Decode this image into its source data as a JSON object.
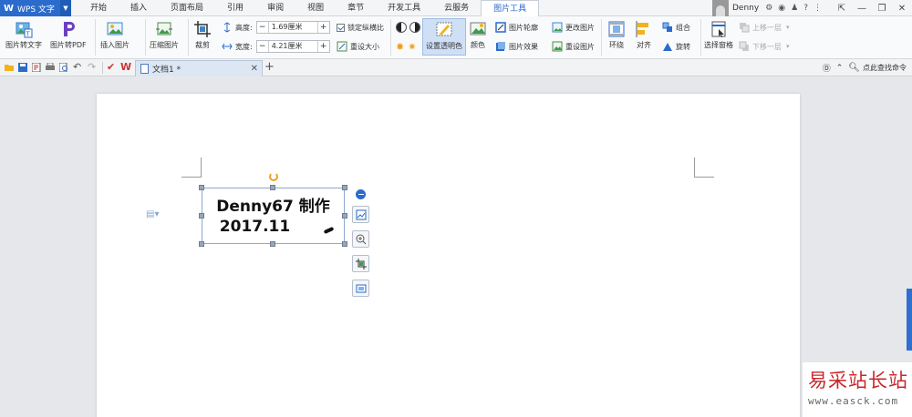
{
  "app": {
    "name": "WPS 文字",
    "logo": "W"
  },
  "menu_tabs": [
    "开始",
    "插入",
    "页面布局",
    "引用",
    "审阅",
    "视图",
    "章节",
    "开发工具",
    "云服务",
    "图片工具"
  ],
  "user": {
    "name": "Denny"
  },
  "ribbon": {
    "pic_to_text": "图片转文字",
    "pic_to_pdf": "图片转PDF",
    "insert_pic": "插入图片",
    "compress_pic": "压缩图片",
    "crop": "裁剪",
    "height_label": "高度:",
    "height_value": "1.69厘米",
    "width_label": "宽度:",
    "width_value": "4.21厘米",
    "lock_ratio": "锁定纵横比",
    "reset_size": "重设大小",
    "set_transparent": "设置透明色",
    "color": "颜色",
    "pic_outline": "图片轮廓",
    "pic_effect": "图片效果",
    "change_pic": "更改图片",
    "reset_pic": "重设图片",
    "wrap": "环绕",
    "align": "对齐",
    "rotate": "旋转",
    "group": "组合",
    "select_pane": "选择窗格",
    "bring_forward": "上移一层",
    "send_backward": "下移一层"
  },
  "doc_tab": {
    "name": "文档1 *"
  },
  "find_cmd": "点此查找命令",
  "image_text": {
    "line1": "Denny67  制作",
    "line2": "2017.11"
  },
  "watermark": {
    "cn": "易采站长站",
    "url": "www.easck.com"
  },
  "colors": {
    "accent": "#2a6bcb",
    "watermark": "#c8282d"
  }
}
